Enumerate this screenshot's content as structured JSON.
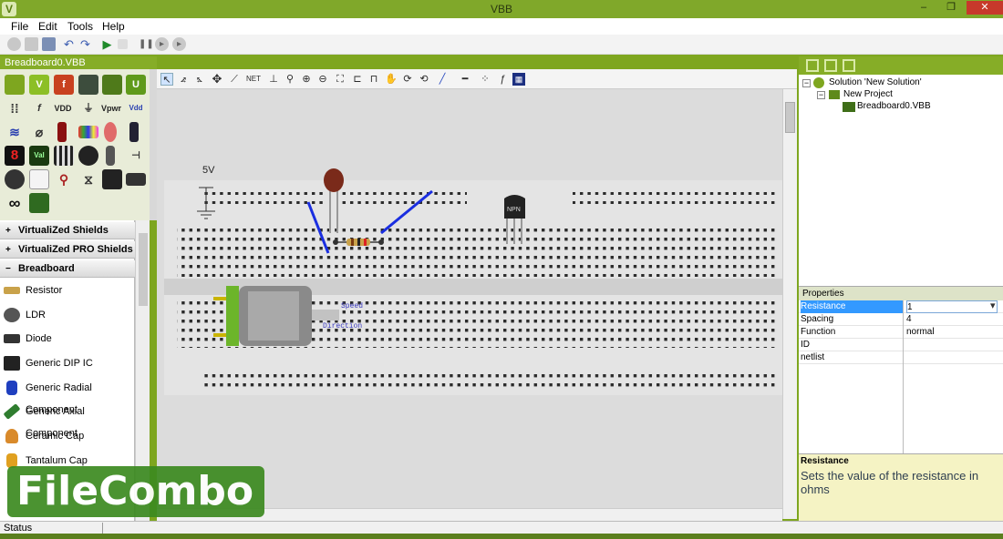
{
  "window": {
    "title": "VBB",
    "minimize_glyph": "‒",
    "restore_glyph": "❐",
    "close_glyph": "✕"
  },
  "menu": [
    "File",
    "Edit",
    "Tools",
    "Help"
  ],
  "toolbar_icons": [
    "new-icon",
    "open-icon",
    "save-icon",
    "undo-icon",
    "redo-icon",
    "run-icon",
    "pause-icon",
    "stop-icon",
    "step-forward-icon",
    "step-end-icon"
  ],
  "document_tab": "Breadboard0.VBB",
  "palette": {
    "rows": [
      [
        {
          "icon": "chameleon-icon",
          "label": ""
        },
        {
          "icon": "v-icon",
          "label": "V"
        },
        {
          "icon": "flash-icon",
          "label": "f"
        },
        {
          "icon": "chip-icon",
          "label": ""
        },
        {
          "icon": "shield-icon",
          "label": ""
        },
        {
          "icon": "shield-u-icon",
          "label": "U"
        }
      ],
      [
        {
          "icon": "grid-icon",
          "label": ""
        },
        {
          "icon": "function-icon",
          "label": "f"
        },
        {
          "icon": "vdd-icon",
          "label": "VDD"
        },
        {
          "icon": "ground-icon",
          "label": ""
        },
        {
          "icon": "vpwr-icon",
          "label": "Vpwr"
        },
        {
          "icon": "vdd-coil-icon",
          "label": "Vdd"
        }
      ],
      [
        {
          "icon": "coil-icon",
          "label": ""
        },
        {
          "icon": "fuse-icon",
          "label": ""
        },
        {
          "icon": "resistor-red-icon",
          "label": ""
        },
        {
          "icon": "color-bar-icon",
          "label": ""
        },
        {
          "icon": "bulb-icon",
          "label": ""
        },
        {
          "icon": "switch-icon",
          "label": ""
        }
      ],
      [
        {
          "icon": "seven-seg-icon",
          "label": "8"
        },
        {
          "icon": "lcd-icon",
          "label": "Val"
        },
        {
          "icon": "keypad-icon",
          "label": ""
        },
        {
          "icon": "sensor-icon",
          "label": ""
        },
        {
          "icon": "mic-icon",
          "label": ""
        },
        {
          "icon": "transistor-icon",
          "label": ""
        }
      ],
      [
        {
          "icon": "pot-icon",
          "label": ""
        },
        {
          "icon": "meter-icon",
          "label": ""
        },
        {
          "icon": "joystick-icon",
          "label": ""
        },
        {
          "icon": "relay-icon",
          "label": ""
        },
        {
          "icon": "display-icon",
          "label": ""
        },
        {
          "icon": "module-icon",
          "label": ""
        }
      ],
      [
        {
          "icon": "infinity-icon",
          "label": "∞"
        },
        {
          "icon": "board-icon",
          "label": ""
        }
      ]
    ]
  },
  "categories": [
    {
      "label": "VirtualiZed Shields",
      "expander": "+"
    },
    {
      "label": "VirtualiZed PRO Shields",
      "expander": "+"
    },
    {
      "label": "Breadboard",
      "expander": "−"
    }
  ],
  "components": [
    {
      "label": "Resistor",
      "icon": "resistor-icon",
      "color": "#c9a24a"
    },
    {
      "label": "LDR",
      "icon": "ldr-icon",
      "color": "#555555"
    },
    {
      "label": "Diode",
      "icon": "diode-icon",
      "color": "#333333"
    },
    {
      "label": "Generic DIP IC",
      "icon": "dip-ic-icon",
      "color": "#222222"
    },
    {
      "label": "Generic Radial Component",
      "icon": "radial-icon",
      "color": "#1f3fbf"
    },
    {
      "label": "Generic Axial Component",
      "icon": "axial-icon",
      "color": "#2f7d2f"
    },
    {
      "label": "Ceramic Cap",
      "icon": "ceramic-cap-icon",
      "color": "#d98a2b"
    },
    {
      "label": "Tantalum Cap",
      "icon": "tantalum-cap-icon",
      "color": "#e0a020"
    }
  ],
  "canvas_tools": [
    "pointer-icon",
    "rotate-left-icon",
    "rotate-right-icon",
    "move-icon",
    "wire-icon",
    "net-icon",
    "probe-icon",
    "search-icon",
    "zoom-in-icon",
    "zoom-out-icon",
    "zoom-fit-icon",
    "flip-h-icon",
    "flip-v-icon",
    "pan-icon",
    "rotate-icon",
    "rotate-ccw-icon",
    "pen-icon",
    "line-icon",
    "nodes-icon",
    "function-icon",
    "select-all-icon"
  ],
  "breadboard": {
    "voltage_label": "5V",
    "transistor_label": "NPN",
    "motor_labels": [
      "Speed",
      "Direction"
    ]
  },
  "solution": {
    "tree": [
      {
        "label": "Solution 'New Solution'",
        "expander": "−"
      },
      {
        "label": "New Project",
        "expander": "−"
      },
      {
        "label": "Breadboard0.VBB",
        "expander": ""
      }
    ]
  },
  "properties": {
    "header": "Properties",
    "rows": [
      {
        "key": "Resistance",
        "value": "1"
      },
      {
        "key": "Spacing",
        "value": "4"
      },
      {
        "key": "Function",
        "value": "normal"
      },
      {
        "key": "ID",
        "value": ""
      },
      {
        "key": "netlist",
        "value": ""
      }
    ],
    "dropdown_glyph": "▾",
    "description_title": "Resistance",
    "description_text": "Sets the value of the resistance in ohms"
  },
  "status": {
    "text": "Status"
  },
  "watermark": "FileCombo",
  "colors": {
    "accent": "#80a82a",
    "selection": "#3399ff",
    "wire": "#1a2ee0"
  }
}
